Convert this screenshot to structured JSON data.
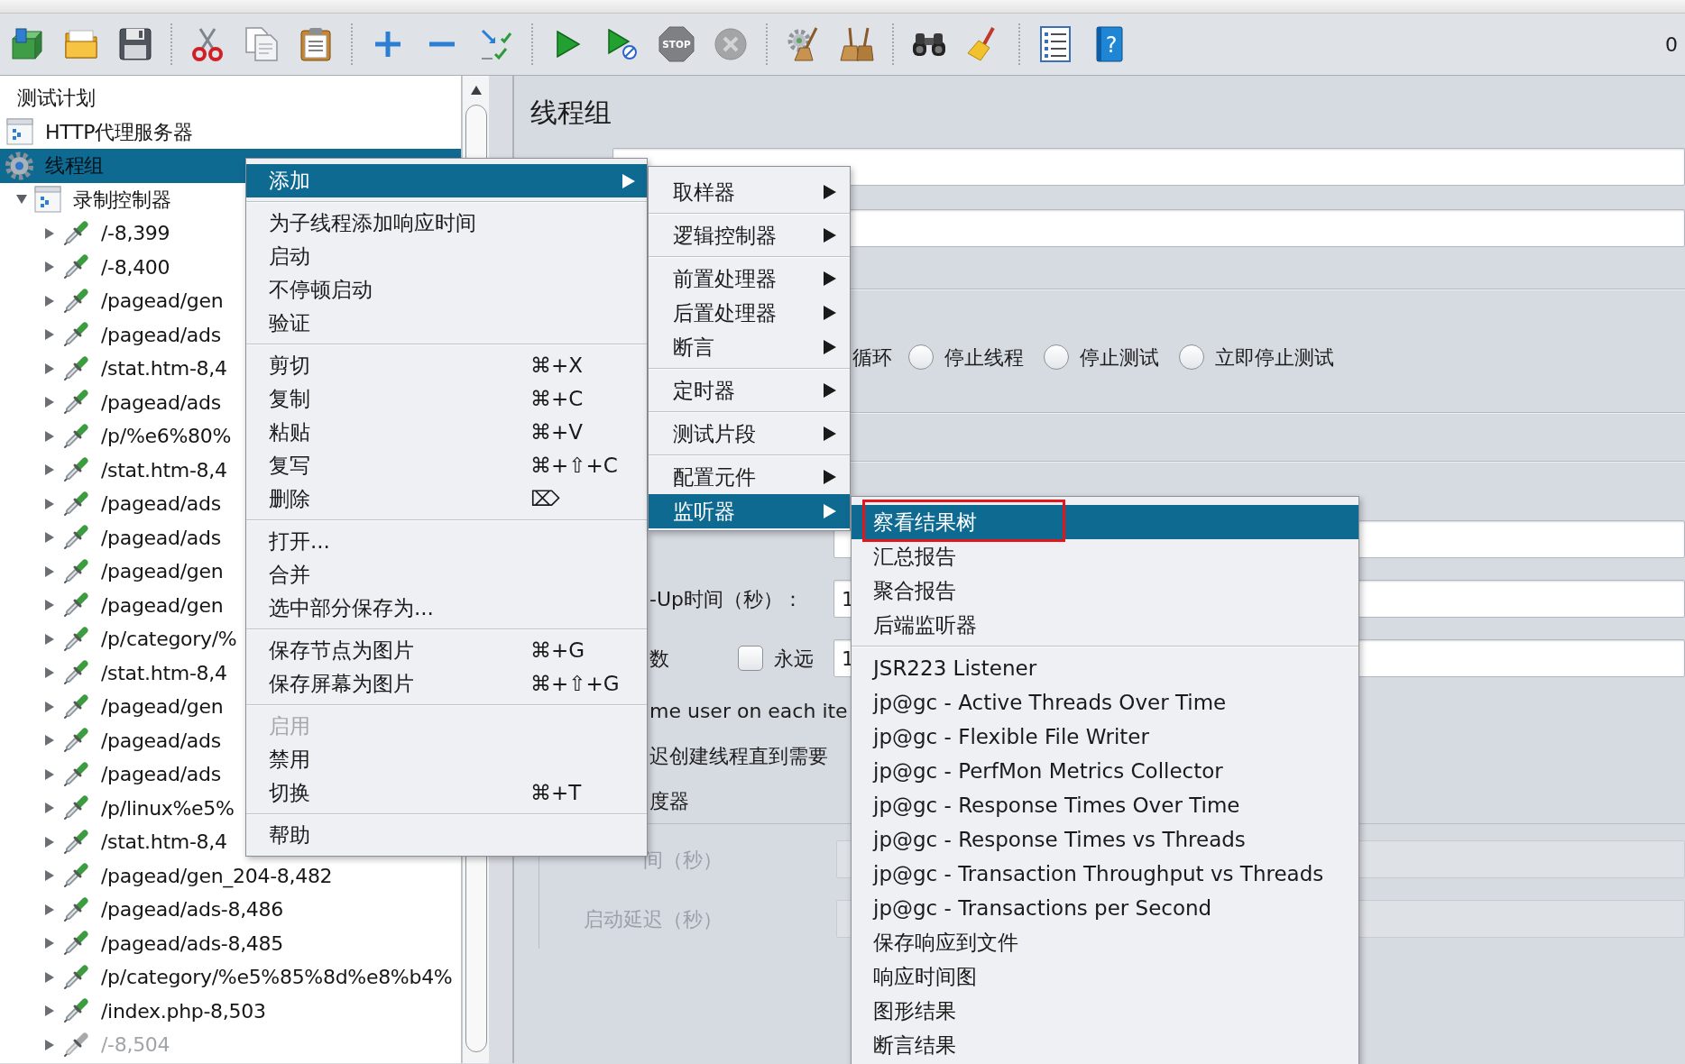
{
  "toolbar": {
    "groups": [
      [
        {
          "kind": "templates",
          "disabled": false
        },
        {
          "kind": "open",
          "disabled": false
        },
        {
          "kind": "save",
          "disabled": false
        }
      ],
      [
        {
          "kind": "cut",
          "disabled": false
        },
        {
          "kind": "copy",
          "disabled": false
        },
        {
          "kind": "paste",
          "disabled": false
        }
      ],
      [
        {
          "kind": "expand",
          "disabled": false
        },
        {
          "kind": "collapse",
          "disabled": false
        },
        {
          "kind": "toggle",
          "disabled": false
        }
      ],
      [
        {
          "kind": "start",
          "disabled": false
        },
        {
          "kind": "start_no_pauses",
          "disabled": false
        },
        {
          "kind": "stop",
          "text": "STOP",
          "disabled": true
        },
        {
          "kind": "shutdown",
          "disabled": true
        }
      ],
      [
        {
          "kind": "clear",
          "disabled": false
        },
        {
          "kind": "clear_all",
          "disabled": false
        }
      ],
      [
        {
          "kind": "search",
          "disabled": false
        },
        {
          "kind": "reset_search",
          "disabled": false
        }
      ],
      [
        {
          "kind": "function_helper",
          "disabled": false
        },
        {
          "kind": "help",
          "text": "?",
          "disabled": false
        }
      ]
    ],
    "timer": "0"
  },
  "tree": {
    "nodes": [
      {
        "label": "测试计划",
        "selected": false,
        "children": [
          {
            "label": "HTTP代理服务器",
            "kind": "proxy",
            "selected": false
          },
          {
            "label": "线程组",
            "kind": "thread_group",
            "selected": true,
            "children": [
              {
                "label": "录制控制器",
                "kind": "controller",
                "selected": false,
                "expanded": true,
                "children": [
                  {
                    "label": "/-8,399",
                    "kind": "sampler",
                    "selected": false,
                    "expanded": false,
                    "disabled": false
                  },
                  {
                    "label": "/-8,400",
                    "kind": "sampler",
                    "selected": false,
                    "expanded": false,
                    "disabled": false
                  },
                  {
                    "label": "/pagead/gen",
                    "kind": "sampler",
                    "selected": false,
                    "expanded": false,
                    "disabled": false
                  },
                  {
                    "label": "/pagead/ads",
                    "kind": "sampler",
                    "selected": false,
                    "expanded": false,
                    "disabled": false
                  },
                  {
                    "label": "/stat.htm-8,4",
                    "kind": "sampler",
                    "selected": false,
                    "expanded": false,
                    "disabled": false
                  },
                  {
                    "label": "/pagead/ads",
                    "kind": "sampler",
                    "selected": false,
                    "expanded": false,
                    "disabled": false
                  },
                  {
                    "label": "/p/%e6%80%",
                    "kind": "sampler",
                    "selected": false,
                    "expanded": false,
                    "disabled": false
                  },
                  {
                    "label": "/stat.htm-8,4",
                    "kind": "sampler",
                    "selected": false,
                    "expanded": false,
                    "disabled": false
                  },
                  {
                    "label": "/pagead/ads",
                    "kind": "sampler",
                    "selected": false,
                    "expanded": false,
                    "disabled": false
                  },
                  {
                    "label": "/pagead/ads",
                    "kind": "sampler",
                    "selected": false,
                    "expanded": false,
                    "disabled": false
                  },
                  {
                    "label": "/pagead/gen",
                    "kind": "sampler",
                    "selected": false,
                    "expanded": false,
                    "disabled": false
                  },
                  {
                    "label": "/pagead/gen",
                    "kind": "sampler",
                    "selected": false,
                    "expanded": false,
                    "disabled": false
                  },
                  {
                    "label": "/p/category/%",
                    "kind": "sampler",
                    "selected": false,
                    "expanded": false,
                    "disabled": false
                  },
                  {
                    "label": "/stat.htm-8,4",
                    "kind": "sampler",
                    "selected": false,
                    "expanded": false,
                    "disabled": false
                  },
                  {
                    "label": "/pagead/gen",
                    "kind": "sampler",
                    "selected": false,
                    "expanded": false,
                    "disabled": false
                  },
                  {
                    "label": "/pagead/ads",
                    "kind": "sampler",
                    "selected": false,
                    "expanded": false,
                    "disabled": false
                  },
                  {
                    "label": "/pagead/ads",
                    "kind": "sampler",
                    "selected": false,
                    "expanded": false,
                    "disabled": false
                  },
                  {
                    "label": "/p/linux%e5%",
                    "kind": "sampler",
                    "selected": false,
                    "expanded": false,
                    "disabled": false
                  },
                  {
                    "label": "/stat.htm-8,4",
                    "kind": "sampler",
                    "selected": false,
                    "expanded": false,
                    "disabled": false
                  },
                  {
                    "label": "/pagead/gen_204-8,482",
                    "kind": "sampler",
                    "selected": false,
                    "expanded": false,
                    "disabled": false
                  },
                  {
                    "label": "/pagead/ads-8,486",
                    "kind": "sampler",
                    "selected": false,
                    "expanded": false,
                    "disabled": false
                  },
                  {
                    "label": "/pagead/ads-8,485",
                    "kind": "sampler",
                    "selected": false,
                    "expanded": false,
                    "disabled": false
                  },
                  {
                    "label": "/p/category/%e5%85%8d%e8%b4%",
                    "kind": "sampler",
                    "selected": false,
                    "expanded": false,
                    "disabled": false
                  },
                  {
                    "label": "/index.php-8,503",
                    "kind": "sampler",
                    "selected": false,
                    "expanded": false,
                    "disabled": false
                  },
                  {
                    "label": "/-8,504",
                    "kind": "sampler",
                    "selected": false,
                    "expanded": false,
                    "disabled": true
                  }
                ]
              }
            ]
          }
        ]
      }
    ]
  },
  "panel": {
    "title": "线程组",
    "error_action": {
      "label_tail": "循环",
      "options": [
        {
          "label": "停止线程",
          "selected": false
        },
        {
          "label": "停止测试",
          "selected": false
        },
        {
          "label": "立即停止测试",
          "selected": false
        }
      ]
    },
    "rows": [
      {
        "kind": "field",
        "disabled": false
      },
      {
        "kind": "labeled_field",
        "label": "-Up时间（秒）：",
        "value": "1",
        "disabled": false
      },
      {
        "kind": "loop",
        "label": "数",
        "checkbox": {
          "label": "永远",
          "checked": false
        },
        "value": "1",
        "disabled": false
      },
      {
        "kind": "text",
        "label": "me user on each ite",
        "disabled": false
      },
      {
        "kind": "text",
        "label": "迟创建线程直到需要",
        "disabled": false
      },
      {
        "kind": "text",
        "label": "度器",
        "disabled": false
      },
      {
        "kind": "scheduler_field",
        "label": "间（秒）",
        "disabled": true
      },
      {
        "kind": "scheduler_field",
        "label": "启动延迟（秒）",
        "disabled": true
      }
    ]
  },
  "context_menu": {
    "groups": [
      [
        {
          "label": "添加",
          "highlighted": true,
          "disabled": false,
          "submenu": true
        }
      ],
      [
        {
          "label": "为子线程添加响应时间",
          "highlighted": false,
          "disabled": false,
          "submenu": false
        },
        {
          "label": "启动",
          "highlighted": false,
          "disabled": false,
          "submenu": false
        },
        {
          "label": "不停顿启动",
          "highlighted": false,
          "disabled": false,
          "submenu": false
        },
        {
          "label": "验证",
          "highlighted": false,
          "disabled": false,
          "submenu": false
        }
      ],
      [
        {
          "label": "剪切",
          "shortcut": "⌘+X",
          "highlighted": false,
          "disabled": false,
          "submenu": false
        },
        {
          "label": "复制",
          "shortcut": "⌘+C",
          "highlighted": false,
          "disabled": false,
          "submenu": false
        },
        {
          "label": "粘贴",
          "shortcut": "⌘+V",
          "highlighted": false,
          "disabled": false,
          "submenu": false
        },
        {
          "label": "复写",
          "shortcut": "⌘+⇧+C",
          "highlighted": false,
          "disabled": false,
          "submenu": false
        },
        {
          "label": "删除",
          "shortcut": "⌦",
          "highlighted": false,
          "disabled": false,
          "submenu": false
        }
      ],
      [
        {
          "label": "打开...",
          "highlighted": false,
          "disabled": false,
          "submenu": false
        },
        {
          "label": "合并",
          "highlighted": false,
          "disabled": false,
          "submenu": false
        },
        {
          "label": "选中部分保存为...",
          "highlighted": false,
          "disabled": false,
          "submenu": false
        }
      ],
      [
        {
          "label": "保存节点为图片",
          "shortcut": "⌘+G",
          "highlighted": false,
          "disabled": false,
          "submenu": false
        },
        {
          "label": "保存屏幕为图片",
          "shortcut": "⌘+⇧+G",
          "highlighted": false,
          "disabled": false,
          "submenu": false
        }
      ],
      [
        {
          "label": "启用",
          "highlighted": false,
          "disabled": true,
          "submenu": false
        },
        {
          "label": "禁用",
          "highlighted": false,
          "disabled": false,
          "submenu": false
        },
        {
          "label": "切换",
          "shortcut": "⌘+T",
          "highlighted": false,
          "disabled": false,
          "submenu": false
        }
      ],
      [
        {
          "label": "帮助",
          "highlighted": false,
          "disabled": false,
          "submenu": false
        }
      ]
    ]
  },
  "add_submenu": {
    "groups": [
      [
        {
          "label": "取样器",
          "highlighted": false,
          "submenu": true
        }
      ],
      [
        {
          "label": "逻辑控制器",
          "highlighted": false,
          "submenu": true
        }
      ],
      [
        {
          "label": "前置处理器",
          "highlighted": false,
          "submenu": true
        },
        {
          "label": "后置处理器",
          "highlighted": false,
          "submenu": true
        },
        {
          "label": "断言",
          "highlighted": false,
          "submenu": true
        }
      ],
      [
        {
          "label": "定时器",
          "highlighted": false,
          "submenu": true
        }
      ],
      [
        {
          "label": "测试片段",
          "highlighted": false,
          "submenu": true
        }
      ],
      [
        {
          "label": "配置元件",
          "highlighted": false,
          "submenu": true
        },
        {
          "label": "监听器",
          "highlighted": true,
          "submenu": true
        }
      ]
    ]
  },
  "listener_submenu": {
    "groups": [
      [
        {
          "label": "察看结果树",
          "highlighted": true,
          "annotated": true
        },
        {
          "label": "汇总报告",
          "highlighted": false,
          "annotated": false
        },
        {
          "label": "聚合报告",
          "highlighted": false,
          "annotated": false
        },
        {
          "label": "后端监听器",
          "highlighted": false,
          "annotated": false
        }
      ],
      [
        {
          "label": "JSR223 Listener",
          "highlighted": false,
          "annotated": false
        },
        {
          "label": "jp@gc - Active Threads Over Time",
          "highlighted": false,
          "annotated": false
        },
        {
          "label": "jp@gc - Flexible File Writer",
          "highlighted": false,
          "annotated": false
        },
        {
          "label": "jp@gc - PerfMon Metrics Collector",
          "highlighted": false,
          "annotated": false
        },
        {
          "label": "jp@gc - Response Times Over Time",
          "highlighted": false,
          "annotated": false
        },
        {
          "label": "jp@gc - Response Times vs Threads",
          "highlighted": false,
          "annotated": false
        },
        {
          "label": "jp@gc - Transaction Throughput vs Threads",
          "highlighted": false,
          "annotated": false
        },
        {
          "label": "jp@gc - Transactions per Second",
          "highlighted": false,
          "annotated": false
        },
        {
          "label": "保存响应到文件",
          "highlighted": false,
          "annotated": false
        },
        {
          "label": "响应时间图",
          "highlighted": false,
          "annotated": false
        },
        {
          "label": "图形结果",
          "highlighted": false,
          "annotated": false
        },
        {
          "label": "断言结果",
          "highlighted": false,
          "annotated": false
        }
      ]
    ]
  }
}
